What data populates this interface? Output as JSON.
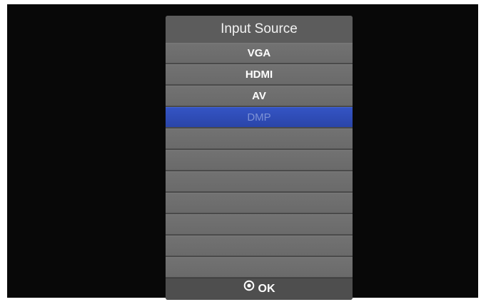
{
  "dialog": {
    "title": "Input Source",
    "items": [
      {
        "label": "VGA",
        "selected": false
      },
      {
        "label": "HDMI",
        "selected": false
      },
      {
        "label": "AV",
        "selected": false
      },
      {
        "label": "DMP",
        "selected": true
      },
      {
        "label": "",
        "selected": false
      },
      {
        "label": "",
        "selected": false
      },
      {
        "label": "",
        "selected": false
      },
      {
        "label": "",
        "selected": false
      },
      {
        "label": "",
        "selected": false
      },
      {
        "label": "",
        "selected": false
      },
      {
        "label": "",
        "selected": false
      }
    ],
    "footer": {
      "icon": "ok-circle-icon",
      "label": "OK"
    }
  },
  "colors": {
    "background": "#080808",
    "panel": "#4a4a4a",
    "item": "#6e6e6e",
    "selected": "#2e4bb6",
    "selected_text": "#7d92d6"
  }
}
